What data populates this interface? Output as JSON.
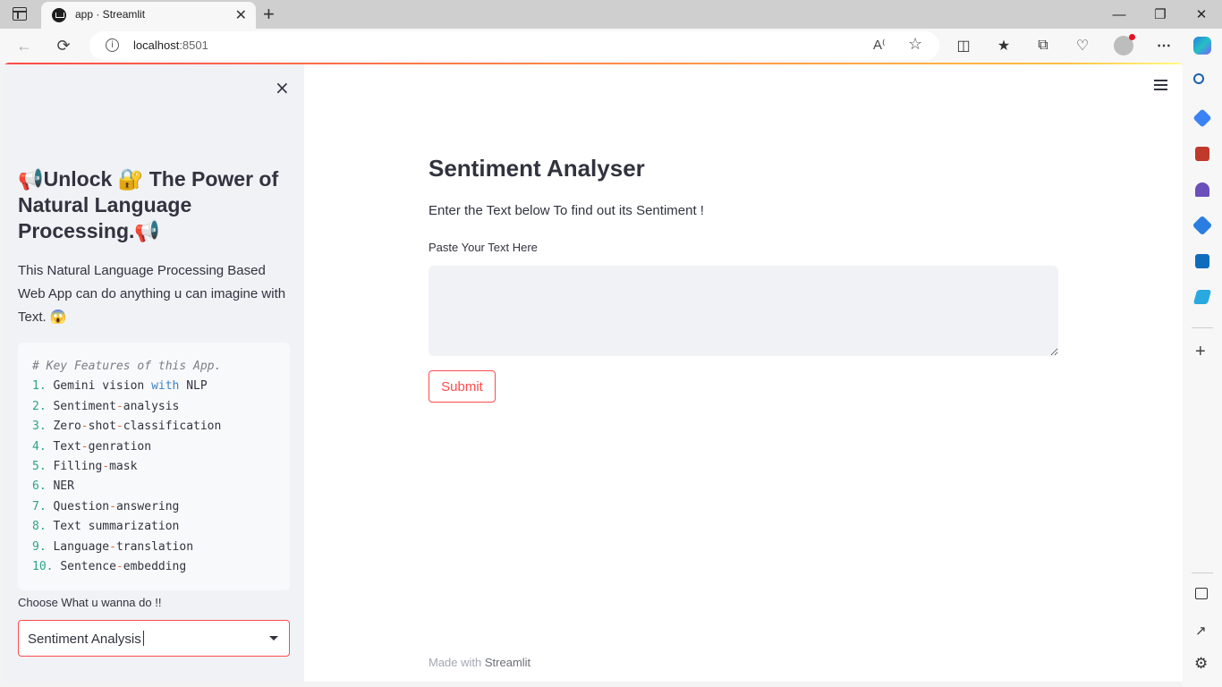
{
  "browser": {
    "tab_title": "app · Streamlit",
    "url_host": "localhost",
    "url_port": ":8501",
    "new_tab": "+",
    "tab_close": "✕",
    "win_minimize": "—",
    "win_restore": "❐",
    "win_close": "✕"
  },
  "sidebar": {
    "close": "×",
    "heading": "📢Unlock 🔐 The Power of Natural Language Processing.📢",
    "description": "This Natural Language Processing Based Web App can do anything u can imagine with Text. 😱",
    "code_comment": "# Key Features of this App.",
    "features": [
      {
        "num": "1.",
        "text": "Gemini vision with NLP"
      },
      {
        "num": "2.",
        "text": "Sentiment-analysis"
      },
      {
        "num": "3.",
        "text": "Zero-shot-classification"
      },
      {
        "num": "4.",
        "text": "Text-genration"
      },
      {
        "num": "5.",
        "text": "Filling-mask"
      },
      {
        "num": "6.",
        "text": "NER"
      },
      {
        "num": "7.",
        "text": "Question-answering"
      },
      {
        "num": "8.",
        "text": "Text summarization"
      },
      {
        "num": "9.",
        "text": "Language-translation"
      },
      {
        "num": "10.",
        "text": "Sentence-embedding"
      }
    ],
    "select_label": "Choose What u wanna do !!",
    "select_value": "Sentiment Analysis"
  },
  "main": {
    "title": "Sentiment Analyser",
    "description": "Enter the Text below To find out its Sentiment !",
    "textarea_label": "Paste Your Text Here",
    "textarea_value": "",
    "submit_label": "Submit",
    "footer_prefix": "Made with",
    "footer_brand": "Streamlit"
  },
  "colors": {
    "accent": "#ff4b4b",
    "sidebar_bg": "#f0f2f6",
    "text": "#31333f"
  }
}
